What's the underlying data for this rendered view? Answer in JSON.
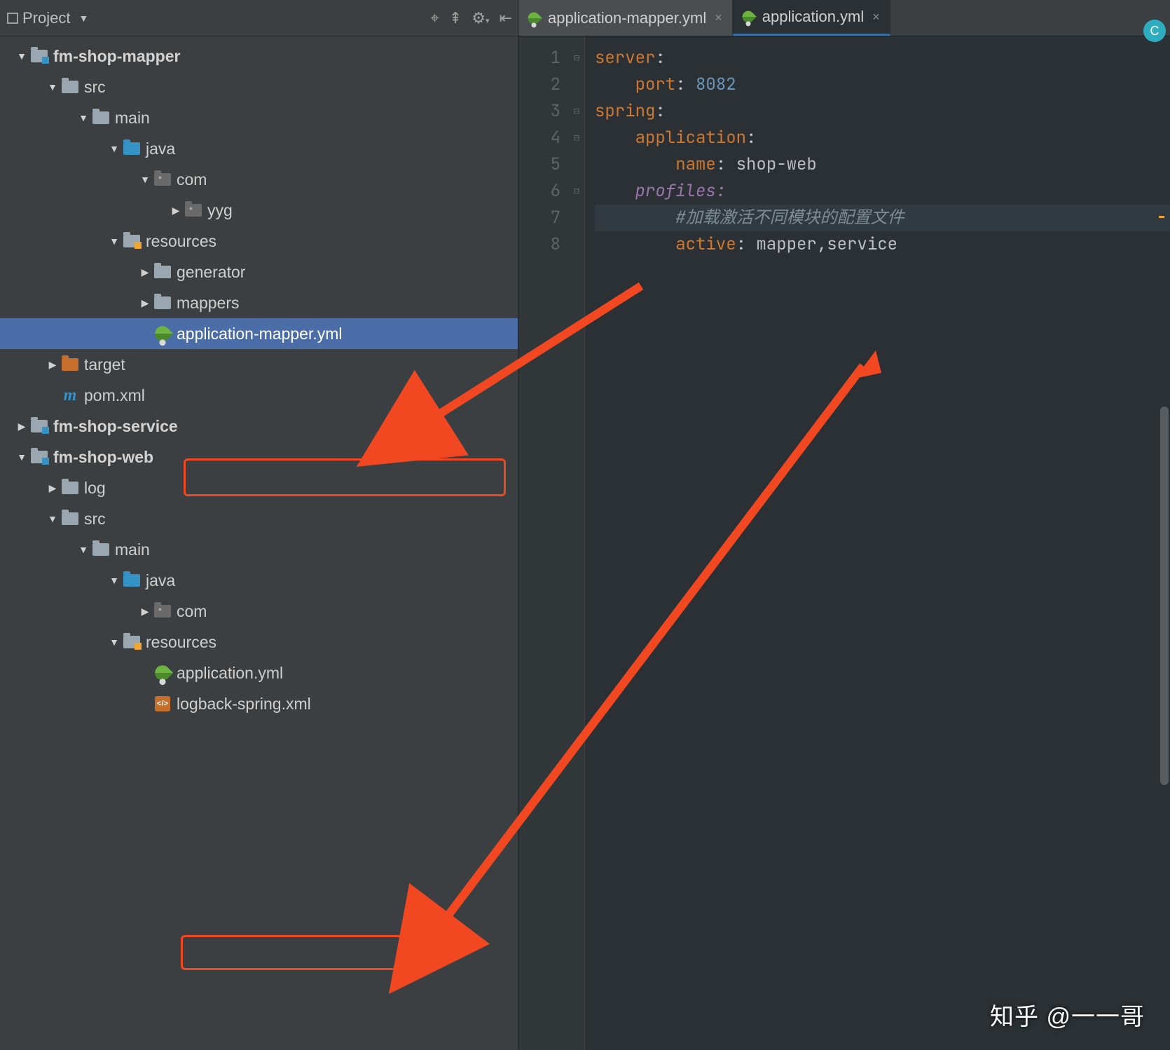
{
  "panel": {
    "title": "Project"
  },
  "toolbar_icons": {
    "target": "⌖",
    "collapse": "⇞",
    "gear": "⚙",
    "gear_arrow": "▾",
    "hide": "⇤"
  },
  "tree": [
    {
      "depth": 0,
      "toggle": "down",
      "icon": "module",
      "label": "fm-shop-mapper",
      "bold": true
    },
    {
      "depth": 1,
      "toggle": "down",
      "icon": "folder",
      "label": "src"
    },
    {
      "depth": 2,
      "toggle": "down",
      "icon": "folder",
      "label": "main"
    },
    {
      "depth": 3,
      "toggle": "down",
      "icon": "blue",
      "label": "java"
    },
    {
      "depth": 4,
      "toggle": "down",
      "icon": "gray-dot",
      "label": "com"
    },
    {
      "depth": 5,
      "toggle": "right",
      "icon": "gray-dot",
      "label": "yyg"
    },
    {
      "depth": 3,
      "toggle": "down",
      "icon": "resources",
      "label": "resources"
    },
    {
      "depth": 4,
      "toggle": "right",
      "icon": "folder",
      "label": "generator"
    },
    {
      "depth": 4,
      "toggle": "right",
      "icon": "folder",
      "label": "mappers"
    },
    {
      "depth": 4,
      "toggle": "blank",
      "icon": "spring",
      "label": "application-mapper.yml",
      "selected": true,
      "redbox": true
    },
    {
      "depth": 1,
      "toggle": "right",
      "icon": "orange",
      "label": "target"
    },
    {
      "depth": 1,
      "toggle": "blank",
      "icon": "maven",
      "label": "pom.xml"
    },
    {
      "depth": 0,
      "toggle": "right",
      "icon": "module",
      "label": "fm-shop-service",
      "bold": true
    },
    {
      "depth": 0,
      "toggle": "down",
      "icon": "module",
      "label": "fm-shop-web",
      "bold": true
    },
    {
      "depth": 1,
      "toggle": "right",
      "icon": "folder",
      "label": "log"
    },
    {
      "depth": 1,
      "toggle": "down",
      "icon": "folder",
      "label": "src"
    },
    {
      "depth": 2,
      "toggle": "down",
      "icon": "folder",
      "label": "main"
    },
    {
      "depth": 3,
      "toggle": "down",
      "icon": "blue",
      "label": "java"
    },
    {
      "depth": 4,
      "toggle": "right",
      "icon": "gray-dot",
      "label": "com"
    },
    {
      "depth": 3,
      "toggle": "down",
      "icon": "resources",
      "label": "resources"
    },
    {
      "depth": 4,
      "toggle": "blank",
      "icon": "spring",
      "label": "application.yml",
      "redbox": true
    },
    {
      "depth": 4,
      "toggle": "blank",
      "icon": "xml",
      "label": "logback-spring.xml"
    }
  ],
  "tabs": [
    {
      "label": "application-mapper.yml",
      "active": false
    },
    {
      "label": "application.yml",
      "active": true
    }
  ],
  "code_lines": [
    {
      "n": "1",
      "segs": [
        [
          "k-orange",
          "server"
        ],
        [
          "p",
          ":"
        ]
      ]
    },
    {
      "n": "2",
      "segs": [
        [
          "indent",
          "  "
        ],
        [
          "k-orange",
          "port"
        ],
        [
          "p",
          ": "
        ],
        [
          "v-num",
          "8082"
        ]
      ]
    },
    {
      "n": "3",
      "segs": [
        [
          "k-orange",
          "spring"
        ],
        [
          "p",
          ":"
        ]
      ]
    },
    {
      "n": "4",
      "segs": [
        [
          "indent",
          "  "
        ],
        [
          "k-orange",
          "application"
        ],
        [
          "p",
          ":"
        ]
      ]
    },
    {
      "n": "5",
      "segs": [
        [
          "indent",
          "    "
        ],
        [
          "k-orange",
          "name"
        ],
        [
          "p",
          ": "
        ],
        [
          "v-str",
          "shop-web"
        ]
      ]
    },
    {
      "n": "6",
      "segs": [
        [
          "indent",
          "  "
        ],
        [
          "k-purple",
          "profiles"
        ],
        [
          "k-purple",
          ":"
        ]
      ]
    },
    {
      "n": "7",
      "segs": [
        [
          "indent",
          "    "
        ],
        [
          "comment",
          "#加载激活不同模块的配置文件"
        ]
      ],
      "current": true
    },
    {
      "n": "8",
      "segs": [
        [
          "indent",
          "    "
        ],
        [
          "k-orange",
          "active"
        ],
        [
          "p",
          ": "
        ],
        [
          "v-str",
          "mapper,service"
        ]
      ]
    }
  ],
  "minimap_badge": "C",
  "watermark": "知乎 @一一哥"
}
